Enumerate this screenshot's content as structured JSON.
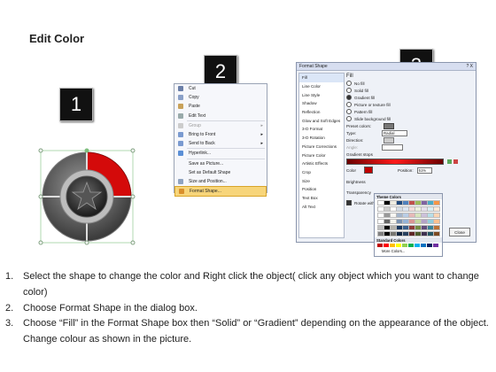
{
  "title": "Edit Color",
  "badges": [
    "1",
    "2",
    "3"
  ],
  "context_menu": {
    "items": [
      {
        "label": "Cut",
        "disabled": false,
        "icon": "scissors-icon"
      },
      {
        "label": "Copy",
        "disabled": false,
        "icon": "copy-icon"
      },
      {
        "label": "Paste",
        "disabled": false,
        "icon": "paste-icon"
      },
      {
        "label": "Edit Text",
        "disabled": false,
        "icon": "text-icon"
      },
      {
        "label": "Group",
        "disabled": true,
        "icon": "group-icon",
        "submenu": true
      },
      {
        "label": "Bring to Front",
        "disabled": false,
        "icon": "bring-front-icon",
        "submenu": true
      },
      {
        "label": "Send to Back",
        "disabled": false,
        "icon": "send-back-icon",
        "submenu": true
      },
      {
        "label": "Hyperlink...",
        "disabled": false,
        "icon": "hyperlink-icon"
      },
      {
        "label": "Save as Picture...",
        "disabled": false,
        "icon": "none"
      },
      {
        "label": "Set as Default Shape",
        "disabled": false,
        "icon": "none"
      },
      {
        "label": "Size and Position...",
        "disabled": false,
        "icon": "size-icon"
      },
      {
        "label": "Format Shape...",
        "disabled": false,
        "icon": "format-icon",
        "highlighted": true
      }
    ]
  },
  "dialog": {
    "title": "Format Shape",
    "title_buttons": "? X",
    "categories": [
      "Fill",
      "Line Color",
      "Line Style",
      "Shadow",
      "Reflection",
      "Glow and Soft Edges",
      "3-D Format",
      "3-D Rotation",
      "Picture Corrections",
      "Picture Color",
      "Artistic Effects",
      "Crop",
      "Size",
      "Position",
      "Text Box",
      "Alt Text"
    ],
    "section": "Fill",
    "fill_options": [
      "No fill",
      "Solid fill",
      "Gradient fill",
      "Picture or texture fill",
      "Pattern fill",
      "Slide background fill"
    ],
    "fill_selected": "Gradient fill",
    "preset_label": "Preset colors:",
    "type_label": "Type:",
    "type_value": "Radial",
    "direction_label": "Direction:",
    "angle_label": "Angle:",
    "stops_label": "Gradient stops",
    "color_label": "Color",
    "position_label": "Position:",
    "position_value": "51%",
    "brightness_label": "Brightness",
    "transparency_label": "Transparency",
    "rotate_label": "Rotate with shape",
    "close_label": "Close"
  },
  "palette": {
    "theme_label": "Theme Colors",
    "standard_label": "Standard Colors",
    "more_label": "More Colors...",
    "theme_top": [
      "#ffffff",
      "#000000",
      "#eeece1",
      "#1f497d",
      "#4f81bd",
      "#c0504d",
      "#9bbb59",
      "#8064a2",
      "#4bacc6",
      "#f79646"
    ],
    "standard": [
      "#c00000",
      "#ff0000",
      "#ffc000",
      "#ffff00",
      "#92d050",
      "#00b050",
      "#00b0f0",
      "#0070c0",
      "#002060",
      "#7030a0"
    ]
  },
  "steps": [
    {
      "n": "1.",
      "text": "Select the shape to change the color and Right click the object( click any object which you want to change color)"
    },
    {
      "n": "2.",
      "text": "Choose Format Shape in the dialog box."
    },
    {
      "n": "3.",
      "text": "Choose “Fill” in the Format Shape box then “Solid” or “Gradient” depending on the appearance of the object. Change colour as shown in the picture."
    }
  ]
}
